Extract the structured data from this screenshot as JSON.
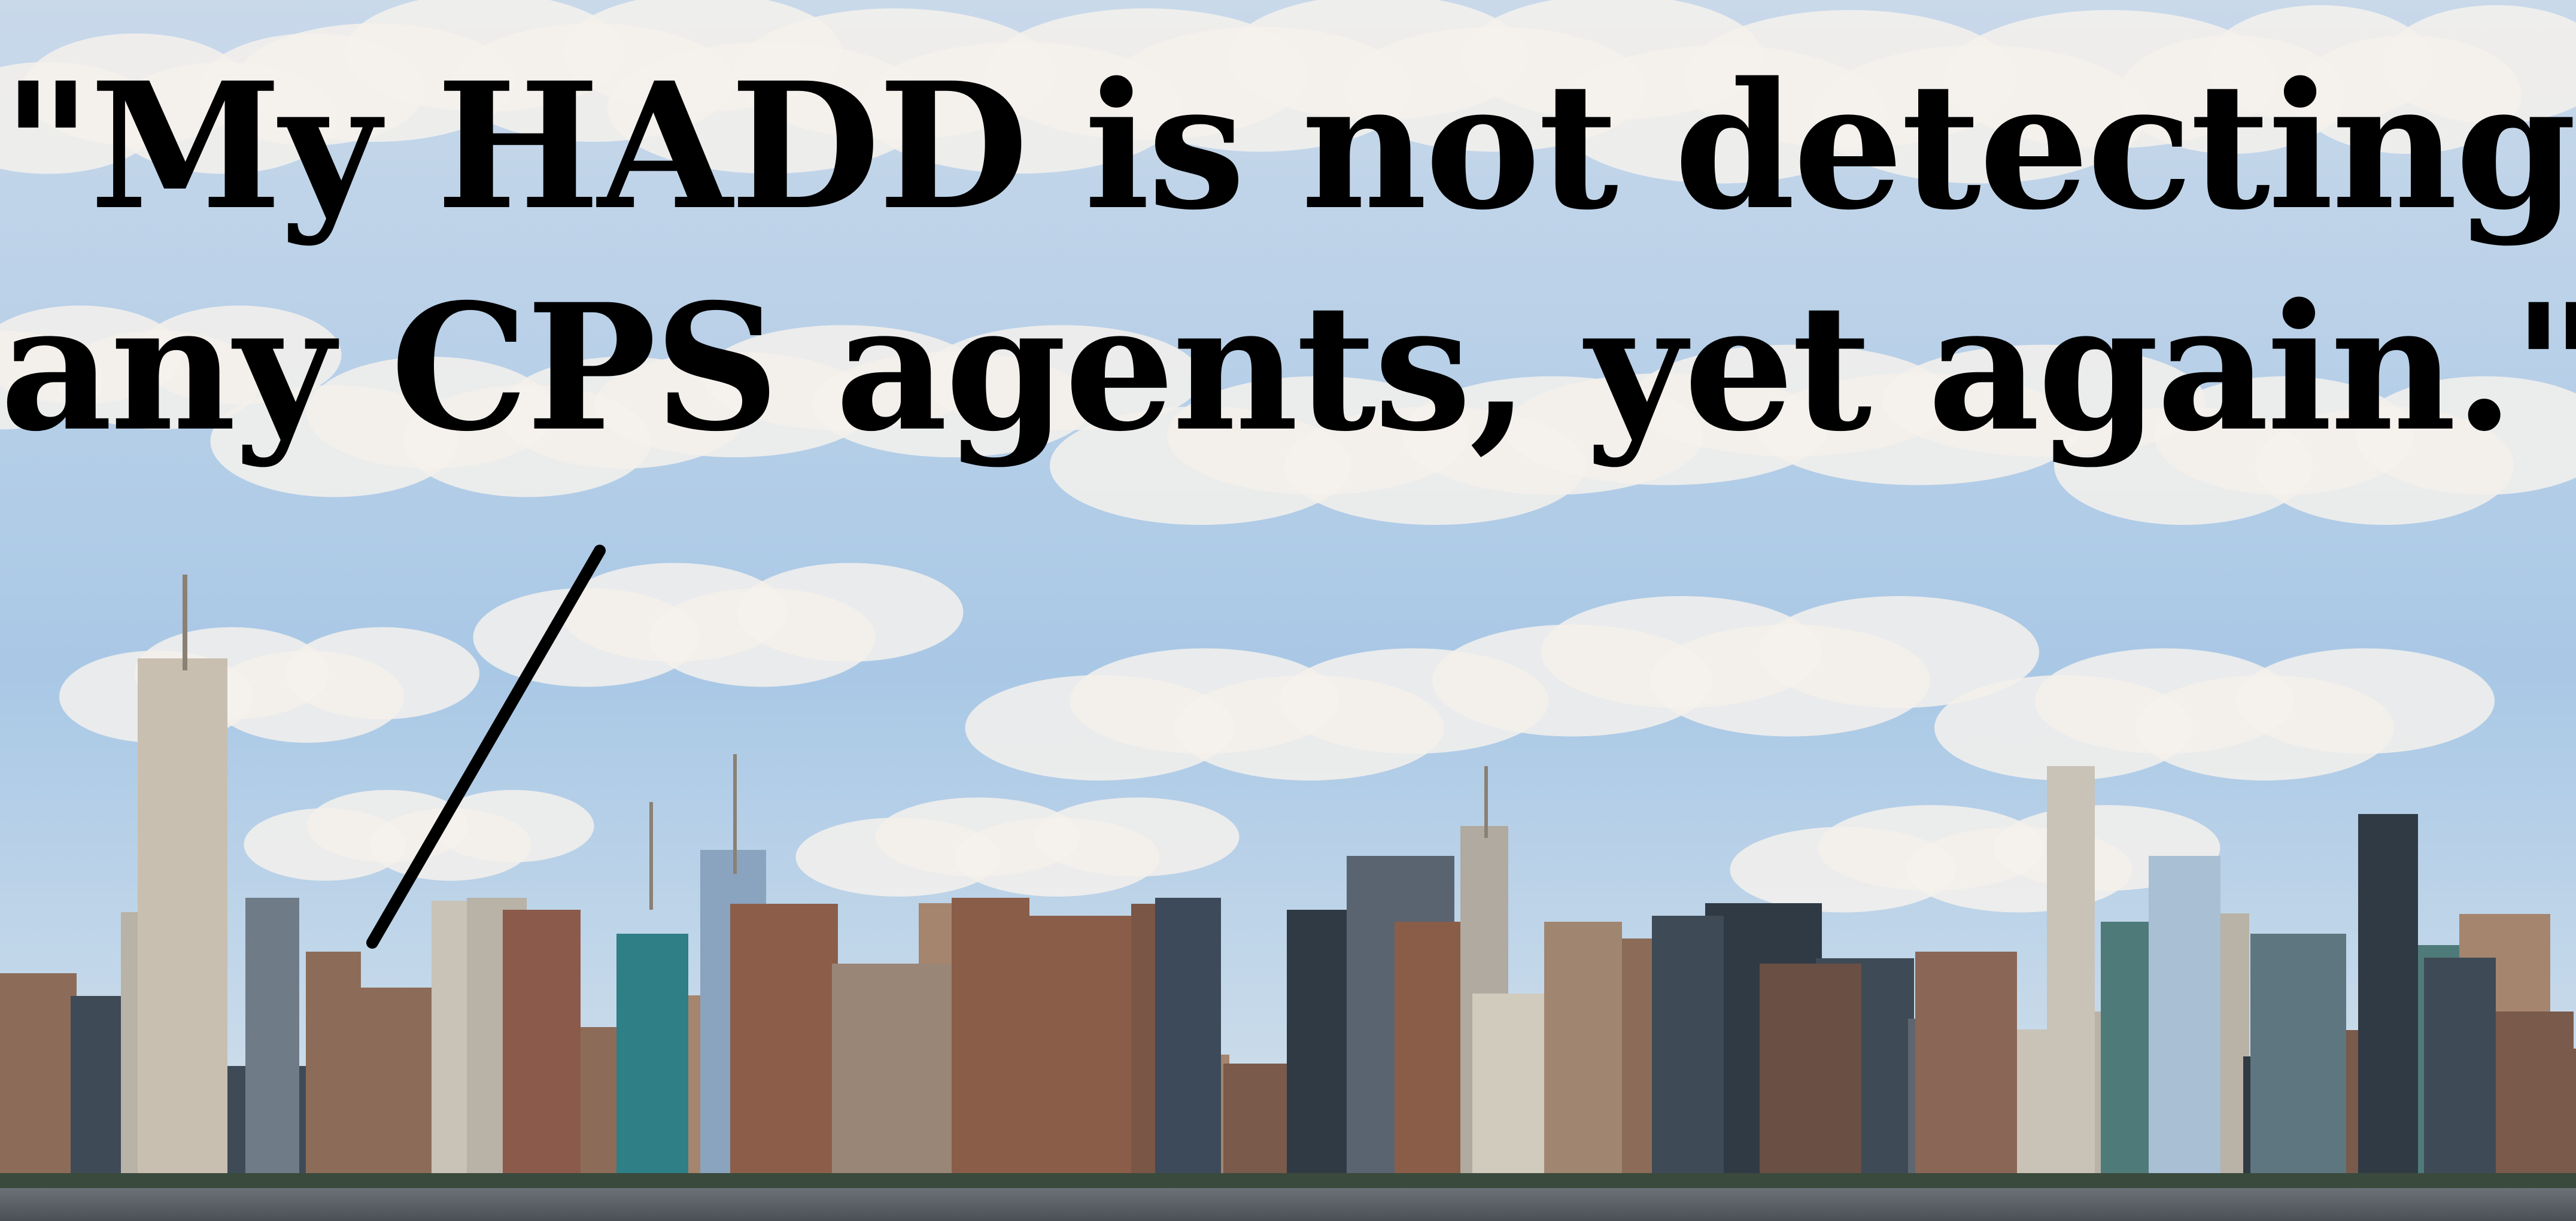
{
  "quote": {
    "line1": "\"My HADD is not detecting",
    "line2": "any CPS agents, yet again.\""
  },
  "scene": {
    "sky_color": "#9ec3e6",
    "cloud_color": "#f4f1ec",
    "water_color": "#5b6166",
    "building_colors": [
      "#7a5a4a",
      "#8c6c58",
      "#a5856e",
      "#5e6670",
      "#3f4a57",
      "#b9b2a6",
      "#4f7a7a",
      "#2f3a44",
      "#c9c2b6"
    ]
  }
}
